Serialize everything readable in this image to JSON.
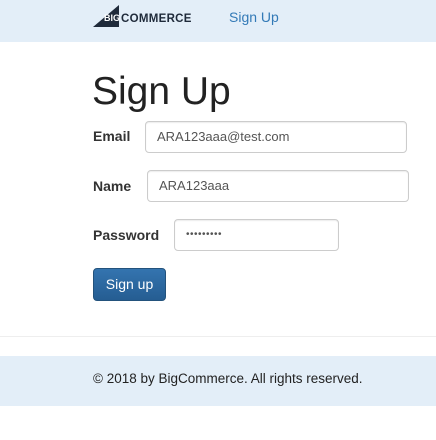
{
  "brand": {
    "logo_big": "BIG",
    "logo_commerce": "COMMERCE"
  },
  "nav": {
    "signup_link": "Sign Up"
  },
  "page": {
    "title": "Sign Up"
  },
  "form": {
    "email_label": "Email",
    "email_value": "ARA123aaa@test.com",
    "name_label": "Name",
    "name_value": "ARA123aaa",
    "password_label": "Password",
    "password_value": "•••••••••",
    "submit_label": "Sign up"
  },
  "footer": {
    "text": "© 2018 by BigCommerce. All rights reserved."
  },
  "colors": {
    "nav_bg": "#e3eef8",
    "link": "#337ab7",
    "button": "#2f6ca5"
  }
}
